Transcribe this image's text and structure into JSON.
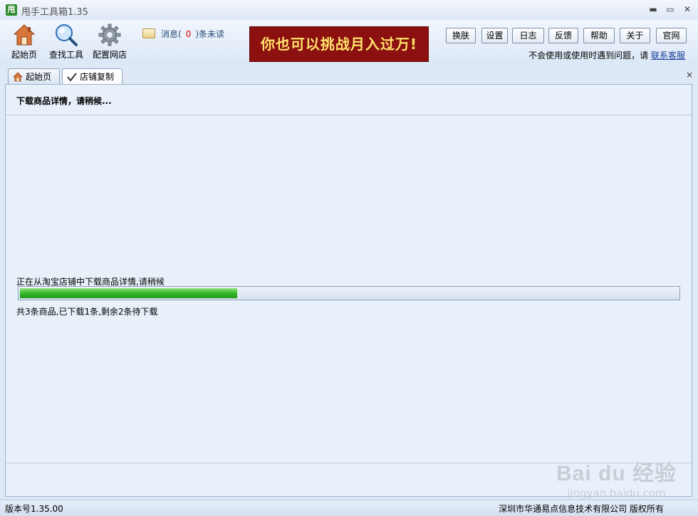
{
  "window": {
    "icon_text": "甩",
    "title": "甩手工具箱1.35",
    "min_glyph": "▬",
    "max_glyph": "▭",
    "close_glyph": "✕"
  },
  "toolbar": {
    "home_label": "起始页",
    "find_label": "查找工具",
    "config_label": "配置网店",
    "msg_prefix": "消息(",
    "msg_count": "0",
    "msg_suffix": ")条未读",
    "banner_text": "你也可以挑战月入过万!",
    "buttons": [
      "换肤",
      "设置",
      "日志",
      "反馈",
      "帮助",
      "关于",
      "官网"
    ],
    "help_prefix": "不会使用或使用时遇到问题，请",
    "help_link": "联系客服"
  },
  "tabs": [
    {
      "label": "起始页",
      "icon": "home-icon"
    },
    {
      "label": "店铺复制",
      "icon": "checkmark-icon"
    }
  ],
  "tab_close_glyph": "×",
  "panel": {
    "title": "下载商品详情，请稍候...",
    "status": "正在从淘宝店铺中下载商品详情,请稍候",
    "progress": 0.33,
    "counts": "共3条商品,已下载1条,剩余2条待下载"
  },
  "statusbar": {
    "version": "版本号1.35.00",
    "copyright": "深圳市华通易点信息技术有限公司 版权所有"
  },
  "watermark": {
    "logo": "Bai du 经验",
    "url": "jingyan.baidu.com"
  },
  "colors": {
    "accent": "#2f8a2f",
    "banner_bg": "#8c1010",
    "banner_text": "#ffe36a",
    "progress_fill": "#36b52a"
  }
}
